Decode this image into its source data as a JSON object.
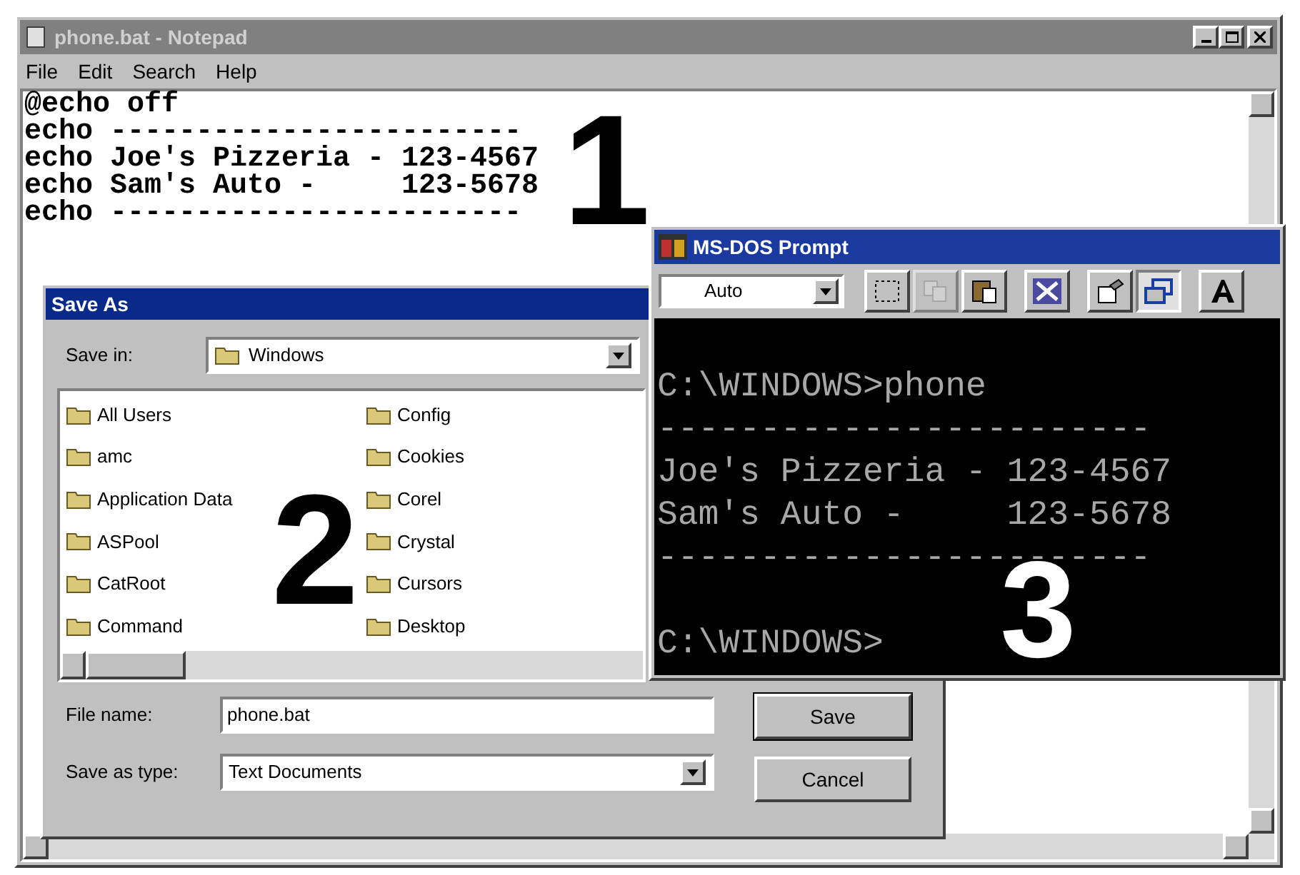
{
  "notepad": {
    "title": "phone.bat - Notepad",
    "menu": [
      "File",
      "Edit",
      "Search",
      "Help"
    ],
    "lines": [
      "@echo off",
      "echo ------------------------",
      "echo Joe's Pizzeria - 123-4567",
      "echo Sam's Auto -     123-5678",
      "echo ------------------------"
    ],
    "callout": "1"
  },
  "save_as": {
    "title": "Save As",
    "save_in_label": "Save in:",
    "save_in_value": "Windows",
    "files": [
      "All Users",
      "amc",
      "Application Data",
      "ASPool",
      "CatRoot",
      "Command",
      "Config",
      "Cookies",
      "Corel",
      "Crystal",
      "Cursors",
      "Desktop"
    ],
    "file_name_label": "File name:",
    "file_name_value": "phone.bat",
    "type_label": "Save as type:",
    "type_value": "Text Documents",
    "buttons": [
      {
        "label": "Save",
        "default": true
      },
      {
        "label": "Cancel",
        "default": false
      }
    ],
    "callout": "2"
  },
  "dos": {
    "title": "MS-DOS Prompt",
    "font_size": "Auto",
    "toolbar": [
      {
        "kind": "mark",
        "disabled": false,
        "pressed": false
      },
      {
        "kind": "copy",
        "disabled": true,
        "pressed": false
      },
      {
        "kind": "paste",
        "disabled": false,
        "pressed": false
      },
      {
        "kind": "fullscreen",
        "disabled": false,
        "pressed": false
      },
      {
        "kind": "properties",
        "disabled": false,
        "pressed": false
      },
      {
        "kind": "background",
        "disabled": false,
        "pressed": true
      },
      {
        "kind": "font",
        "disabled": false,
        "pressed": false
      }
    ],
    "lines": [
      "C:\\WINDOWS>phone",
      "------------------------",
      "Joe's Pizzeria - 123-4567",
      "Sam's Auto -     123-5678",
      "------------------------"
    ],
    "prompt": "C:\\WINDOWS>",
    "callout": "3"
  }
}
